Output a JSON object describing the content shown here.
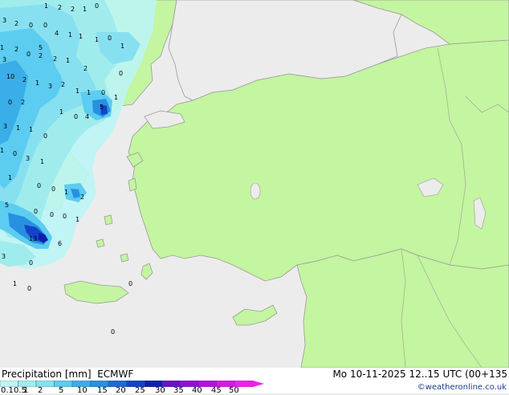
{
  "header": {
    "title": "Precipitation [mm]",
    "model": "ECMWF",
    "datetime": "Mo 10-11-2025 12..15 UTC (00+135",
    "credit": "©weatheronline.co.uk"
  },
  "legend": {
    "labels": [
      "0.1",
      "0.5",
      "1",
      "2",
      "5",
      "10",
      "15",
      "20",
      "25",
      "30",
      "35",
      "40",
      "45",
      "50"
    ],
    "colors": [
      "#bdf5f5",
      "#a0ecec",
      "#86e0f0",
      "#5cccf0",
      "#3aaee8",
      "#2890e0",
      "#1c6ad8",
      "#1244c8",
      "#0c20b0",
      "#6a10c8",
      "#9010d8",
      "#b410e0",
      "#d818e8",
      "#f020f0"
    ]
  },
  "colors": {
    "land": "#c4f5a0",
    "sea": "#ececec",
    "border": "#9a9a9a"
  },
  "precip_values": [
    "3",
    "2",
    "0",
    "1",
    "2",
    "2",
    "1",
    "0",
    "1",
    "2",
    "0",
    "4",
    "1",
    "1",
    "1",
    "0",
    "1",
    "3",
    "0",
    "5",
    "2",
    "2",
    "1",
    "2",
    "0",
    "10",
    "2",
    "1",
    "3",
    "2",
    "1",
    "1",
    "0",
    "1",
    "0",
    "2",
    "4",
    "5",
    "1",
    "0",
    "3",
    "1",
    "1",
    "0",
    "1",
    "0",
    "3",
    "1",
    "1",
    "0",
    "1",
    "0",
    "2",
    "5",
    "0",
    "0",
    "1",
    "0",
    "13",
    "6",
    "3",
    "0",
    "1",
    "0",
    "0",
    "0"
  ]
}
